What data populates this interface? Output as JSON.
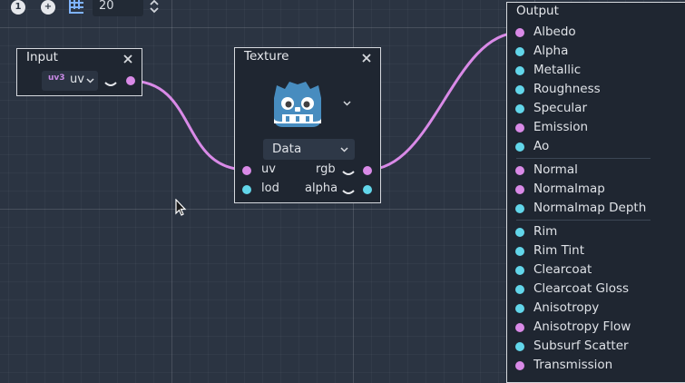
{
  "toolbar": {
    "zoom_out_label": "1",
    "zoom_in_label": "+",
    "snap_value": "20",
    "icons": [
      "zoom-reset-icon",
      "zoom-in-icon",
      "grid-snap-icon",
      "up-down-arrows-icon"
    ]
  },
  "colors": {
    "background": "#2b3442",
    "node_body": "#1f2631",
    "port_vector": "#d98ae7",
    "port_scalar": "#62d6ea",
    "wire": "#d98ae7"
  },
  "input_node": {
    "title": "Input",
    "type_badge": "uv3",
    "selected": "uv"
  },
  "texture_node": {
    "title": "Texture",
    "source_select": "Data",
    "inputs": [
      {
        "label": "uv",
        "type": "vector"
      },
      {
        "label": "lod",
        "type": "scalar"
      }
    ],
    "outputs": [
      {
        "label": "rgb",
        "type": "vector"
      },
      {
        "label": "alpha",
        "type": "scalar"
      }
    ]
  },
  "output_node": {
    "title": "Output",
    "ports": [
      {
        "label": "Albedo",
        "type": "vector"
      },
      {
        "label": "Alpha",
        "type": "scalar"
      },
      {
        "label": "Metallic",
        "type": "scalar"
      },
      {
        "label": "Roughness",
        "type": "scalar"
      },
      {
        "label": "Specular",
        "type": "scalar"
      },
      {
        "label": "Emission",
        "type": "vector"
      },
      {
        "label": "Ao",
        "type": "scalar"
      },
      {
        "label": "Normal",
        "type": "vector"
      },
      {
        "label": "Normalmap",
        "type": "vector"
      },
      {
        "label": "Normalmap Depth",
        "type": "scalar"
      },
      {
        "label": "Rim",
        "type": "scalar"
      },
      {
        "label": "Rim Tint",
        "type": "scalar"
      },
      {
        "label": "Clearcoat",
        "type": "scalar"
      },
      {
        "label": "Clearcoat Gloss",
        "type": "scalar"
      },
      {
        "label": "Anisotropy",
        "type": "scalar"
      },
      {
        "label": "Anisotropy Flow",
        "type": "vector"
      },
      {
        "label": "Subsurf Scatter",
        "type": "scalar"
      },
      {
        "label": "Transmission",
        "type": "vector"
      }
    ]
  }
}
